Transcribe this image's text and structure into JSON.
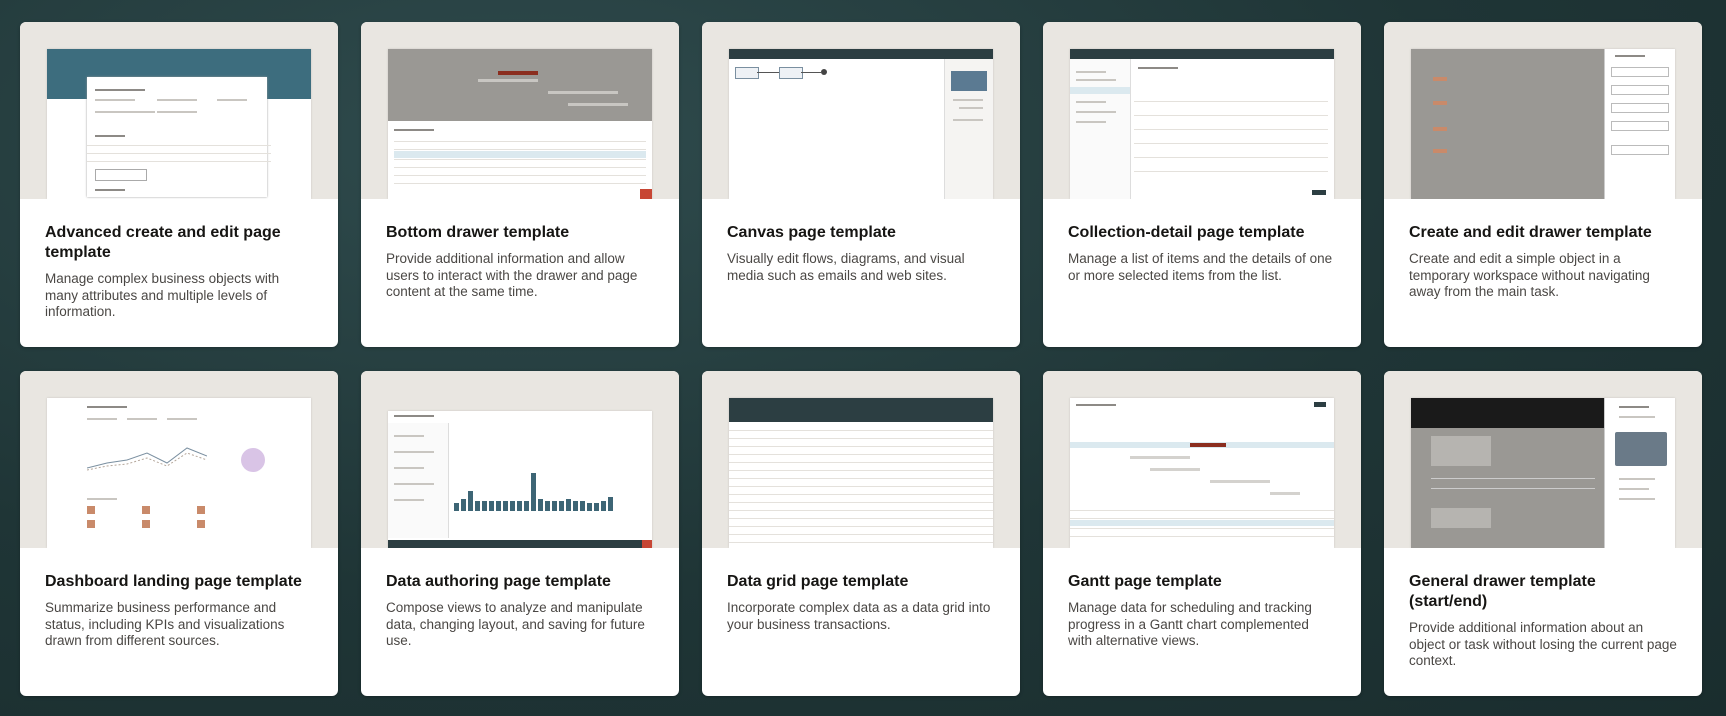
{
  "cards": [
    {
      "title": "Advanced create and edit page template",
      "description": "Manage complex business objects with many attributes and multiple levels of information."
    },
    {
      "title": "Bottom drawer template",
      "description": "Provide additional information and allow users to interact with the drawer and page content at the same time."
    },
    {
      "title": "Canvas page template",
      "description": "Visually edit flows, diagrams, and visual media such as emails and web sites."
    },
    {
      "title": "Collection-detail page template",
      "description": "Manage a list of items and the details of one or more selected items from the list."
    },
    {
      "title": "Create and edit drawer template",
      "description": "Create and edit a simple object in a temporary workspace without navigating away from the main task."
    },
    {
      "title": "Dashboard landing page template",
      "description": "Summarize business performance and status, including KPIs and visualizations drawn from different sources."
    },
    {
      "title": "Data authoring page template",
      "description": "Compose views to analyze and manipulate data, changing layout, and saving for future use."
    },
    {
      "title": "Data grid page template",
      "description": "Incorporate complex data as a data grid into your business transactions."
    },
    {
      "title": "Gantt page template",
      "description": "Manage data for scheduling and tracking progress in a Gantt chart complemented with alternative views."
    },
    {
      "title": "General drawer template (start/end)",
      "description": "Provide additional information about an object or task without losing the current page context."
    }
  ],
  "colors": {
    "page_background": "#1f3536",
    "card_background": "#ffffff",
    "thumbnail_background": "#e9e6e1",
    "title_text": "#161513",
    "description_text": "#4a4744",
    "teal_header": "#3d6d7e",
    "dark_header": "#2c3e42",
    "chart_bar": "#3d6575",
    "accent_orange": "#c74634"
  }
}
